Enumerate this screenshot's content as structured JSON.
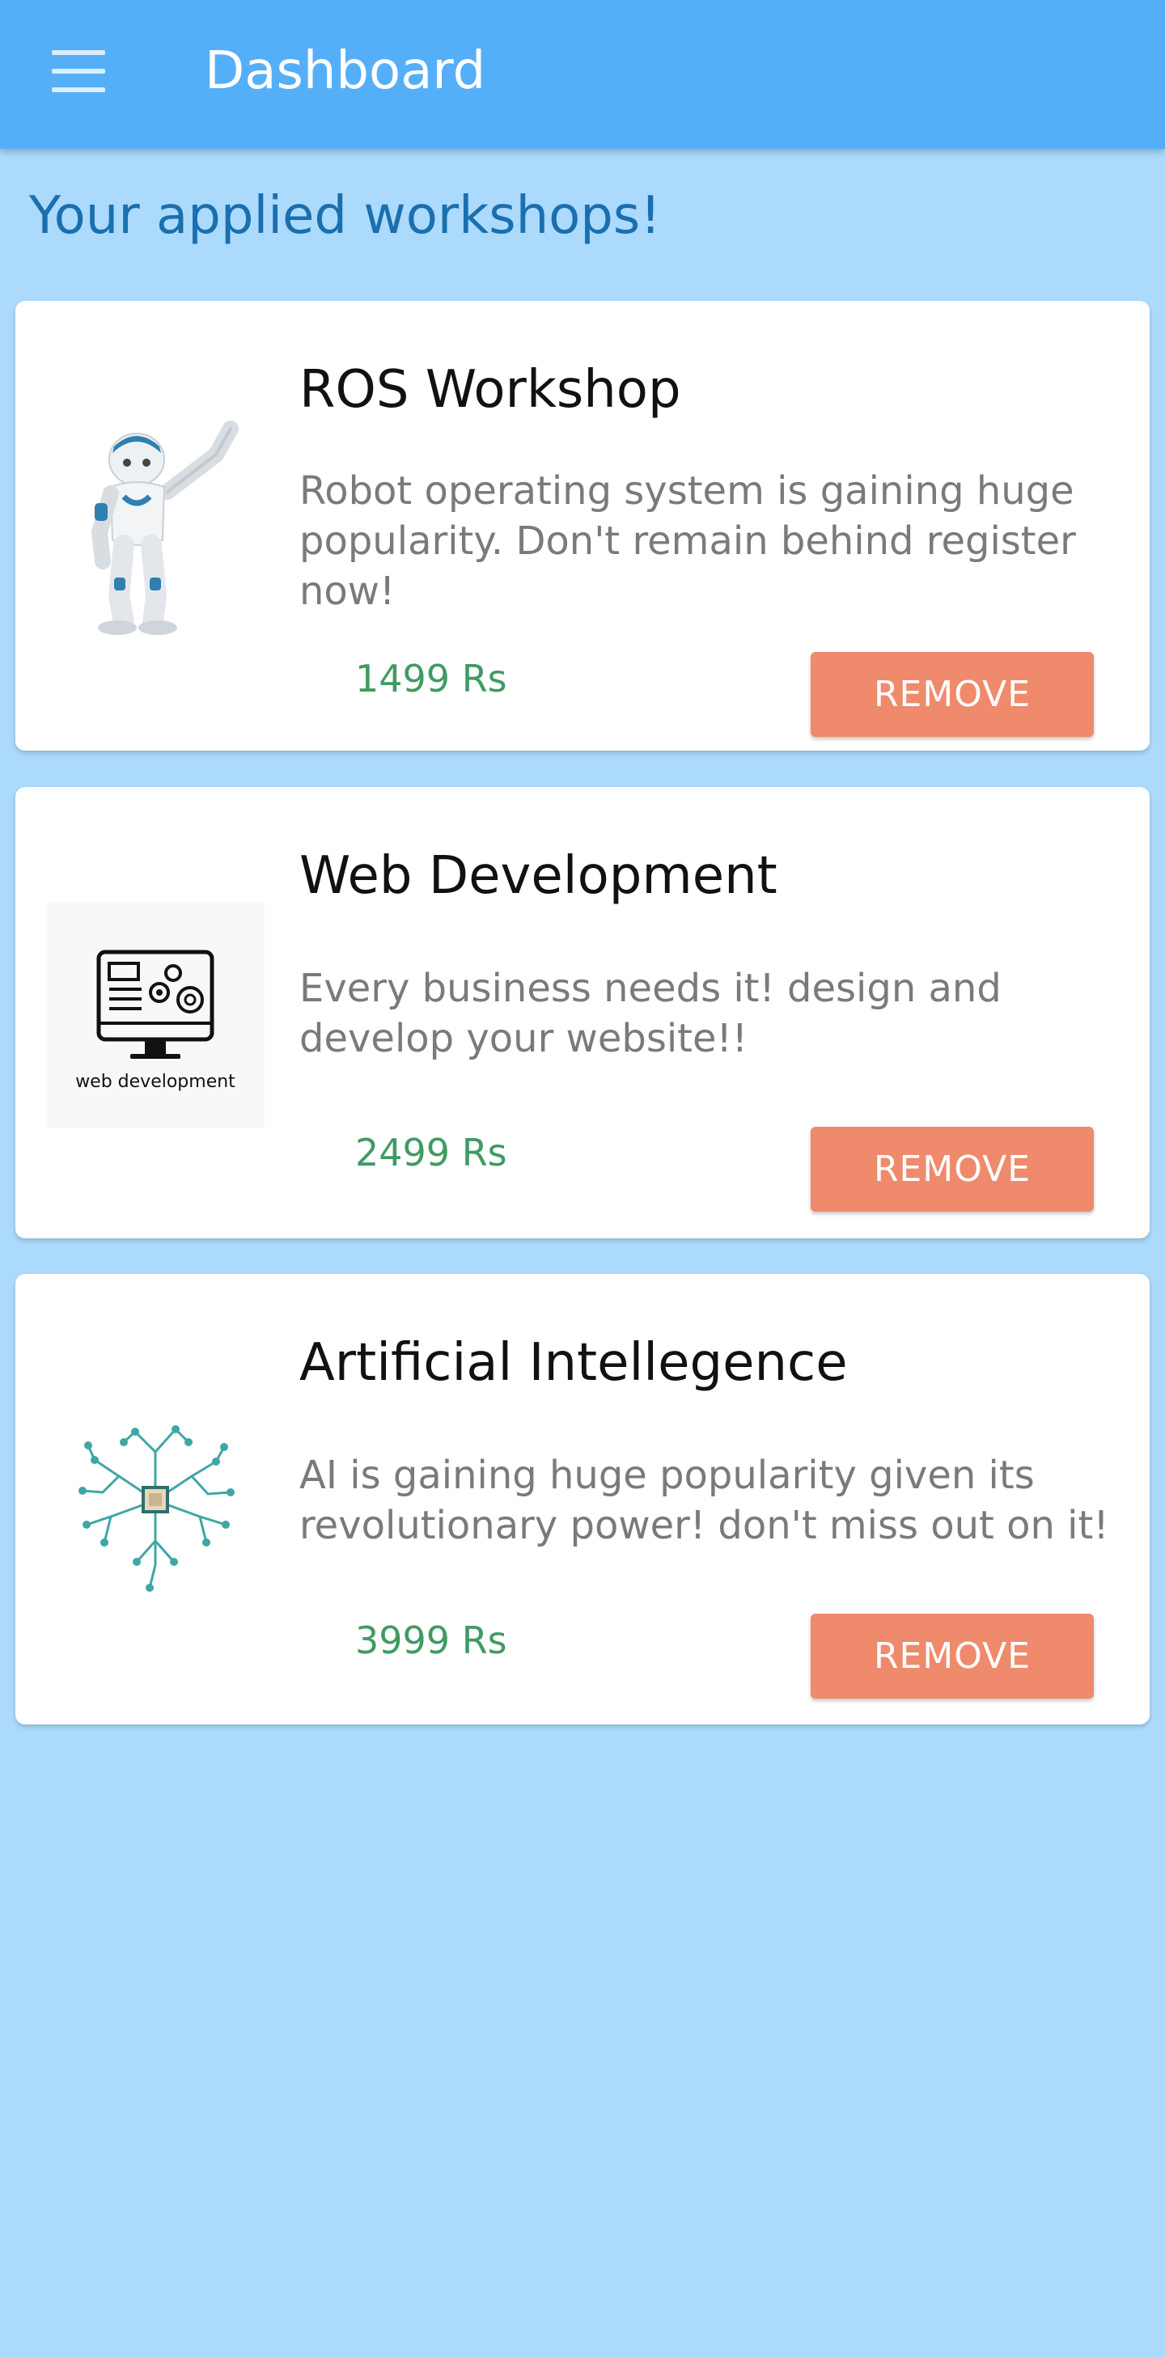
{
  "appbar": {
    "title": "Dashboard",
    "menu_icon": "hamburger-menu-icon",
    "background": "#55aff8"
  },
  "page": {
    "heading": "Your applied workshops!",
    "background": "#acdafd"
  },
  "workshops": [
    {
      "title": "ROS Workshop",
      "description": "Robot operating system is gaining huge popularity. Don't remain behind register now!",
      "price": "1499 Rs",
      "button_label": "REMOVE",
      "image": "robot-image"
    },
    {
      "title": "Web Development",
      "description": "Every business needs it! design and develop your website!!",
      "price": "2499 Rs",
      "button_label": "REMOVE",
      "image": "web-development-image",
      "image_caption": "web development"
    },
    {
      "title": "Artificial Intellegence",
      "description": "AI is gaining huge popularity given its revolutionary power! don't miss out on it!",
      "price": "3999 Rs",
      "button_label": "REMOVE",
      "image": "ai-circuit-brain-image"
    }
  ],
  "colors": {
    "accent": "#ef8a6d",
    "price": "#3f9b62",
    "heading": "#1a6fae"
  }
}
